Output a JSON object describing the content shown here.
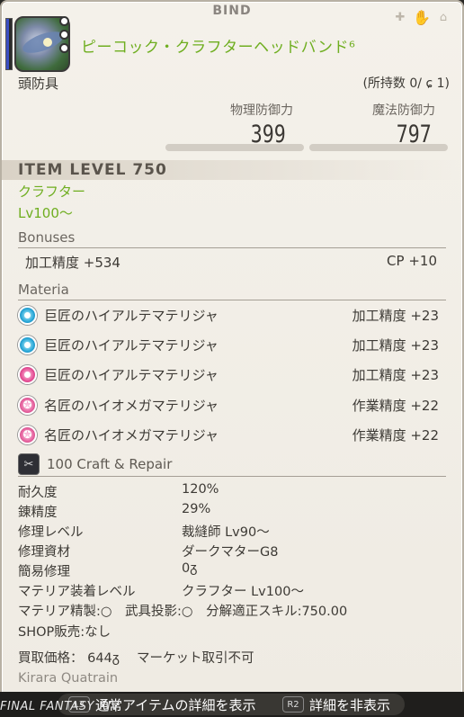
{
  "header": {
    "bind": "BIND",
    "item_name": "ピーコック・クラフターヘッドバンド",
    "hq_icon": "hq-icon",
    "category": "頭防具",
    "owned": "(所持数 0/",
    "owned_hq": "1)"
  },
  "stats": {
    "phys_label": "物理防御力",
    "phys_value": "399",
    "magic_label": "魔法防御力",
    "magic_value": "797"
  },
  "item_level": "ITEM LEVEL 750",
  "class_job": "クラフター",
  "level": "Lv100～",
  "bonuses": {
    "title": "Bonuses",
    "left": "加工精度 +534",
    "right": "CP +10"
  },
  "materia": {
    "title": "Materia",
    "items": [
      {
        "name": "巨匠のハイアルテマテリジャ",
        "stat": "加工精度 +23",
        "icon": "blue-materia-icon"
      },
      {
        "name": "巨匠のハイアルテマテリジャ",
        "stat": "加工精度 +23",
        "icon": "blue-materia-icon"
      },
      {
        "name": "巨匠のハイアルテマテリジャ",
        "stat": "加工精度 +23",
        "icon": "pink-materia-icon"
      },
      {
        "name": "名匠のハイオメガマテリジャ",
        "stat": "作業精度 +22",
        "icon": "star-materia-icon"
      },
      {
        "name": "名匠のハイオメガマテリジャ",
        "stat": "作業精度 +22",
        "icon": "star-materia-icon"
      }
    ]
  },
  "craft": {
    "title": "100 Craft & Repair",
    "rows": [
      {
        "k": "耐久度",
        "v": "120%"
      },
      {
        "k": "錬精度",
        "v": "29%"
      },
      {
        "k": "修理レベル",
        "v": "裁縫師 Lv90～"
      },
      {
        "k": "修理資材",
        "v": "ダークマターG8"
      },
      {
        "k": "簡易修理",
        "v": "0ᵹ"
      },
      {
        "k": "マテリア装着レベル",
        "v": "クラフター Lv100～"
      }
    ],
    "line1": "マテリア精製:○　武具投影:○　分解適正スキル:750.00",
    "line2": "SHOP販売:なし"
  },
  "price": "買取価格： 644ᵹ　 マーケット取引不可",
  "crafter": "Kirara Quatrain",
  "footer": {
    "logo": "FINAL FANTASY XIV",
    "l3_key": "L3",
    "l3_label": "通常アイテムの詳細を表示",
    "r2_key": "R2",
    "r2_label": "詳細を非表示"
  }
}
